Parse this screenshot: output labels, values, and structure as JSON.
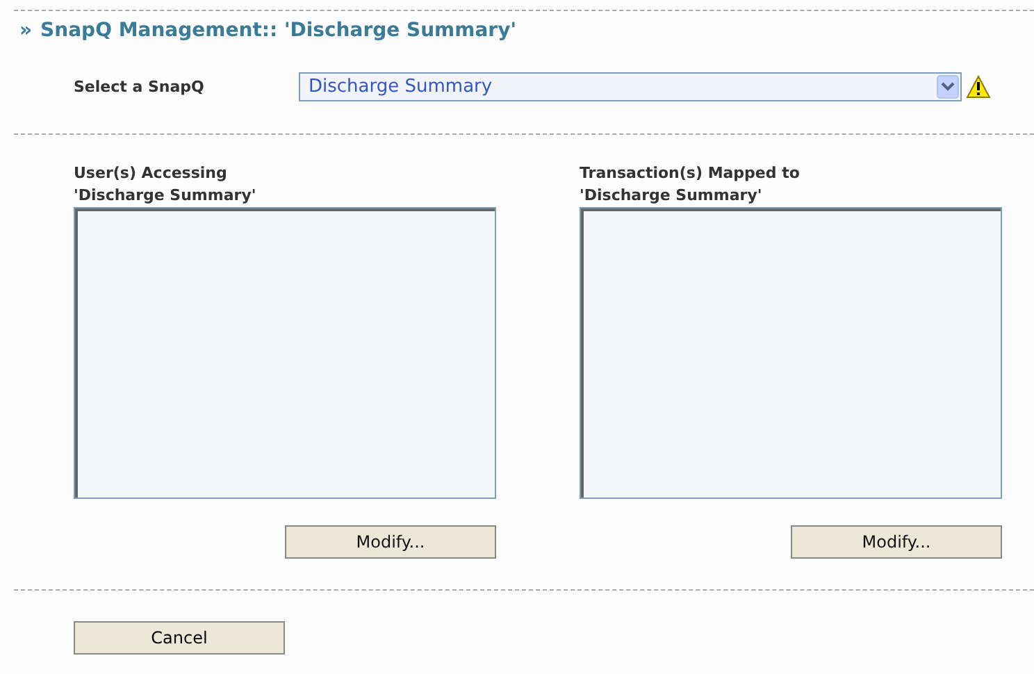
{
  "title": {
    "marker": "»",
    "text": "SnapQ Management:: 'Discharge Summary'"
  },
  "select": {
    "label": "Select a SnapQ",
    "value": "Discharge Summary",
    "warning": true
  },
  "lists": [
    {
      "label": "User(s) Accessing\n'Discharge Summary'",
      "button": "Modify..."
    },
    {
      "label": "Transaction(s) Mapped to\n'Discharge Summary'",
      "button": "Modify..."
    }
  ],
  "buttons": [
    "Cancel"
  ]
}
